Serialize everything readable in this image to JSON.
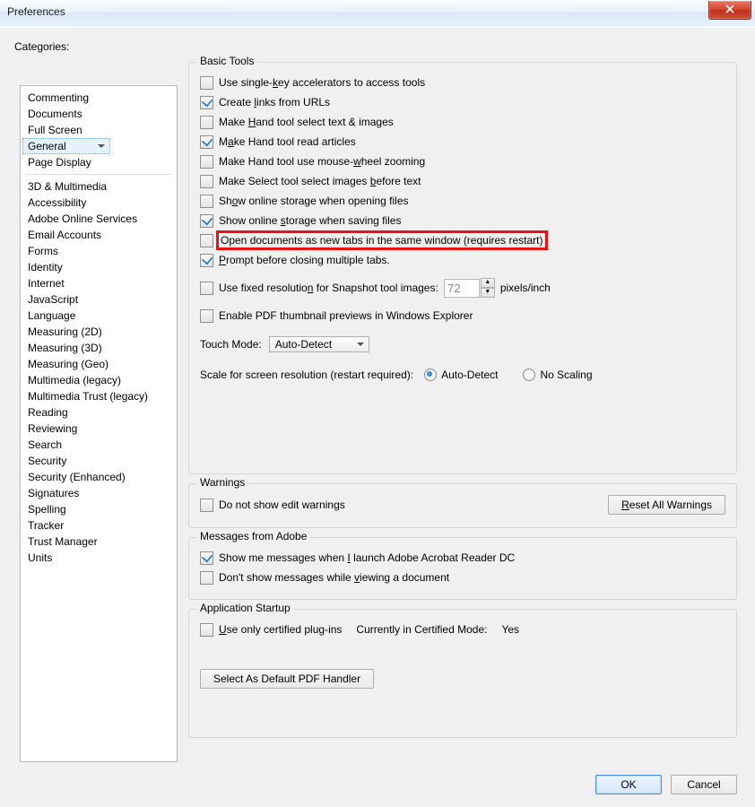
{
  "window": {
    "title": "Preferences"
  },
  "sidebar": {
    "label": "Categories:",
    "group1": [
      "Commenting",
      "Documents",
      "Full Screen",
      "General",
      "Page Display"
    ],
    "selected": "General",
    "group2": [
      "3D & Multimedia",
      "Accessibility",
      "Adobe Online Services",
      "Email Accounts",
      "Forms",
      "Identity",
      "Internet",
      "JavaScript",
      "Language",
      "Measuring (2D)",
      "Measuring (3D)",
      "Measuring (Geo)",
      "Multimedia (legacy)",
      "Multimedia Trust (legacy)",
      "Reading",
      "Reviewing",
      "Search",
      "Security",
      "Security (Enhanced)",
      "Signatures",
      "Spelling",
      "Tracker",
      "Trust Manager",
      "Units"
    ]
  },
  "basic": {
    "legend": "Basic Tools",
    "items": [
      {
        "checked": false,
        "label": "Use single-key accelerators to access tools",
        "u": "k"
      },
      {
        "checked": true,
        "label": "Create links from URLs",
        "u": "l"
      },
      {
        "checked": false,
        "label": "Make Hand tool select text & images",
        "u": "H"
      },
      {
        "checked": true,
        "label": "Make Hand tool read articles",
        "u": "a"
      },
      {
        "checked": false,
        "label": "Make Hand tool use mouse-wheel zooming",
        "u": "w"
      },
      {
        "checked": false,
        "label": "Make Select tool select images before text",
        "u": "b"
      },
      {
        "checked": false,
        "label": "Show online storage when opening files",
        "u": "o"
      },
      {
        "checked": true,
        "label": "Show online storage when saving files",
        "u": "s"
      },
      {
        "checked": false,
        "label": "Open documents as new tabs in the same window (requires restart)",
        "u": "",
        "hl": true
      },
      {
        "checked": true,
        "label": "Prompt before closing multiple tabs.",
        "u": "P"
      }
    ],
    "snapshot": {
      "checked": false,
      "label": "Use fixed resolution for Snapshot tool images:",
      "u": "n",
      "value": "72",
      "unit": "pixels/inch"
    },
    "thumb": {
      "checked": false,
      "label": "Enable PDF thumbnail previews in Windows Explorer"
    },
    "touch": {
      "label": "Touch Mode:",
      "value": "Auto-Detect"
    },
    "scale": {
      "label": "Scale for screen resolution (restart required):",
      "opt1": "Auto-Detect",
      "opt2": "No Scaling",
      "sel": "opt1"
    }
  },
  "warnings": {
    "legend": "Warnings",
    "cb": {
      "checked": false,
      "label": "Do not show edit warnings"
    },
    "reset": "Reset All Warnings",
    "u": "R"
  },
  "adobe": {
    "legend": "Messages from Adobe",
    "m1": {
      "checked": true,
      "label": "Show me messages when I launch Adobe Acrobat Reader DC",
      "u": "I"
    },
    "m2": {
      "checked": false,
      "label": "Don't show messages while viewing a document",
      "u": "v"
    }
  },
  "startup": {
    "legend": "Application Startup",
    "cert": {
      "checked": false,
      "label": "Use only certified plug-ins",
      "u": "U",
      "status_l": "Currently in Certified Mode:",
      "status_v": "Yes"
    },
    "defbtn": "Select As Default PDF Handler"
  },
  "footer": {
    "ok": "OK",
    "cancel": "Cancel"
  }
}
